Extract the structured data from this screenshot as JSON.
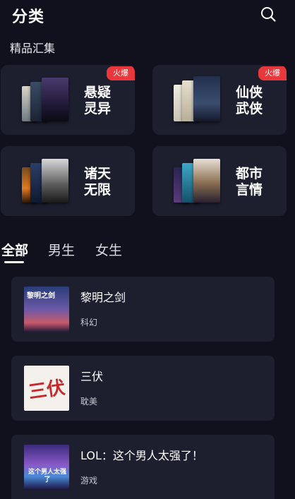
{
  "header": {
    "title": "分类",
    "search_icon": "search-icon"
  },
  "section": {
    "title": "精品汇集"
  },
  "categories": [
    {
      "label": "悬疑灵异",
      "badge": "火爆"
    },
    {
      "label": "仙侠武侠",
      "badge": "火爆"
    },
    {
      "label": "诸天无限",
      "badge": ""
    },
    {
      "label": "都市言情",
      "badge": ""
    }
  ],
  "tabs": [
    {
      "label": "全部",
      "active": true
    },
    {
      "label": "男生",
      "active": false
    },
    {
      "label": "女生",
      "active": false
    }
  ],
  "books": [
    {
      "title": "黎明之剑",
      "genre": "科幻",
      "cover_text": "黎明之剑"
    },
    {
      "title": "三伏",
      "genre": "耽美",
      "cover_text": "三伏"
    },
    {
      "title": "LOL：这个男人太强了！",
      "genre": "游戏",
      "cover_text": "这个男人太强了"
    }
  ],
  "colors": {
    "background": "#10111d",
    "card": "#1d1f2e",
    "badge": "#e8383b"
  }
}
